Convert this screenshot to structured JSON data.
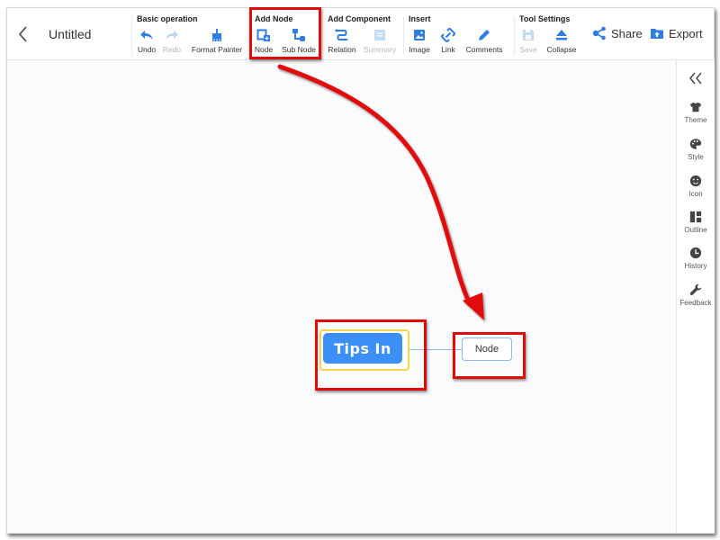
{
  "header": {
    "back_icon": "chevron-left-icon",
    "title": "Untitled"
  },
  "toolbar": {
    "groups": [
      {
        "label": "Basic operation",
        "tools": [
          {
            "label": "Undo",
            "icon": "undo-icon",
            "enabled": true
          },
          {
            "label": "Redo",
            "icon": "redo-icon",
            "enabled": false
          },
          {
            "label": "Format Painter",
            "icon": "format-painter-icon",
            "enabled": true
          }
        ]
      },
      {
        "label": "Add Node",
        "tools": [
          {
            "label": "Node",
            "icon": "add-node-icon",
            "enabled": true
          },
          {
            "label": "Sub Node",
            "icon": "sub-node-icon",
            "enabled": true
          }
        ]
      },
      {
        "label": "Add Component",
        "tools": [
          {
            "label": "Relation",
            "icon": "relation-icon",
            "enabled": true
          },
          {
            "label": "Summary",
            "icon": "summary-icon",
            "enabled": false
          }
        ]
      },
      {
        "label": "Insert",
        "tools": [
          {
            "label": "Image",
            "icon": "image-icon",
            "enabled": true
          },
          {
            "label": "Link",
            "icon": "link-icon",
            "enabled": true
          },
          {
            "label": "Comments",
            "icon": "pencil-icon",
            "enabled": true
          }
        ]
      },
      {
        "label": "Tool Settings",
        "tools": [
          {
            "label": "Save",
            "icon": "save-icon",
            "enabled": false
          },
          {
            "label": "Collapse",
            "icon": "collapse-icon",
            "enabled": true
          }
        ]
      }
    ],
    "share_label": "Share",
    "export_label": "Export"
  },
  "sidebar": {
    "collapse_icon": "double-chevron-left-icon",
    "items": [
      {
        "label": "Theme",
        "icon": "tshirt-icon"
      },
      {
        "label": "Style",
        "icon": "palette-icon"
      },
      {
        "label": "Icon",
        "icon": "smiley-icon"
      },
      {
        "label": "Outline",
        "icon": "outline-layout-icon"
      },
      {
        "label": "History",
        "icon": "clock-icon"
      },
      {
        "label": "Feedback",
        "icon": "wrench-icon"
      }
    ]
  },
  "mindmap": {
    "root_label": "Tips  In",
    "child_label": "Node"
  },
  "colors": {
    "accent": "#3b8ff7",
    "root_border": "#f8d44a",
    "annotation": "#e10a0a"
  }
}
